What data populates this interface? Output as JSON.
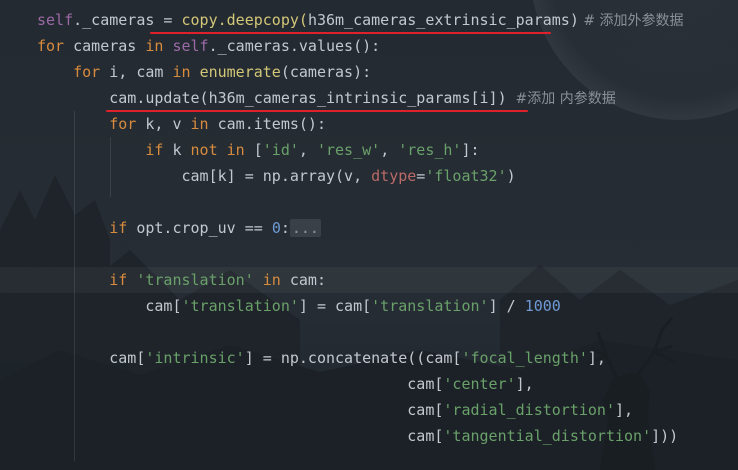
{
  "editor": {
    "lines": [
      {
        "tokens": [
          [
            "self",
            "self"
          ],
          [
            "._cameras = ",
            ""
          ],
          [
            "copy.deepcopy(",
            "fn"
          ],
          [
            "h36m_cameras_extrinsic_params",
            ""
          ],
          [
            ")",
            ""
          ],
          [
            " # 添加外参数据",
            "cm"
          ]
        ]
      },
      {
        "tokens": [
          [
            "for",
            "kw"
          ],
          [
            " cameras ",
            ""
          ],
          [
            "in",
            "kw"
          ],
          [
            " ",
            ""
          ],
          [
            "self",
            "self"
          ],
          [
            "._cameras.values():",
            ""
          ]
        ]
      },
      {
        "tokens": [
          [
            "    ",
            ""
          ],
          [
            "for",
            "kw"
          ],
          [
            " i, cam ",
            ""
          ],
          [
            "in",
            "kw"
          ],
          [
            " ",
            ""
          ],
          [
            "enumerate",
            "fn"
          ],
          [
            "(cameras):",
            ""
          ]
        ]
      },
      {
        "tokens": [
          [
            "        cam.update(h36m_cameras_intrinsic_params[i])",
            ""
          ],
          [
            "  #添加 内参数据",
            "cm"
          ]
        ]
      },
      {
        "tokens": [
          [
            "        ",
            ""
          ],
          [
            "for",
            "kw"
          ],
          [
            " k, v ",
            ""
          ],
          [
            "in",
            "kw"
          ],
          [
            " cam.items():",
            ""
          ]
        ]
      },
      {
        "tokens": [
          [
            "            ",
            ""
          ],
          [
            "if",
            "kw"
          ],
          [
            " k ",
            ""
          ],
          [
            "not in",
            "kw"
          ],
          [
            " [",
            ""
          ],
          [
            "'id'",
            "str"
          ],
          [
            ", ",
            ""
          ],
          [
            "'res_w'",
            "str"
          ],
          [
            ", ",
            ""
          ],
          [
            "'res_h'",
            "str"
          ],
          [
            "]:",
            ""
          ]
        ]
      },
      {
        "tokens": [
          [
            "                cam[k] = np.array(v, ",
            ""
          ],
          [
            "dtype",
            "prm"
          ],
          [
            "=",
            ""
          ],
          [
            "'float32'",
            "str"
          ],
          [
            ")",
            ""
          ]
        ]
      },
      {
        "tokens": []
      },
      {
        "tokens": [
          [
            "        ",
            ""
          ],
          [
            "if",
            "kw"
          ],
          [
            " opt.crop_uv == ",
            ""
          ],
          [
            "0",
            "num"
          ],
          [
            ":",
            ""
          ],
          [
            "...",
            "fold"
          ]
        ]
      },
      {
        "tokens": []
      },
      {
        "tokens": [
          [
            "        ",
            ""
          ],
          [
            "if",
            "kw"
          ],
          [
            " ",
            ""
          ],
          [
            "'translation'",
            "str"
          ],
          [
            " ",
            ""
          ],
          [
            "in",
            "kw"
          ],
          [
            " cam:",
            ""
          ]
        ]
      },
      {
        "tokens": [
          [
            "            cam[",
            ""
          ],
          [
            "'translation'",
            "str"
          ],
          [
            "] = cam[",
            ""
          ],
          [
            "'translation'",
            "str"
          ],
          [
            "] / ",
            ""
          ],
          [
            "1000",
            "num"
          ]
        ]
      },
      {
        "tokens": []
      },
      {
        "tokens": [
          [
            "        cam[",
            ""
          ],
          [
            "'intrinsic'",
            "str"
          ],
          [
            "] = np.concatenate((cam[",
            ""
          ],
          [
            "'focal_length'",
            "str"
          ],
          [
            "],",
            ""
          ]
        ]
      },
      {
        "tokens": [
          [
            "                                         cam[",
            ""
          ],
          [
            "'center'",
            "str"
          ],
          [
            "],",
            ""
          ]
        ]
      },
      {
        "tokens": [
          [
            "                                         cam[",
            ""
          ],
          [
            "'radial_distortion'",
            "str"
          ],
          [
            "],",
            ""
          ]
        ]
      },
      {
        "tokens": [
          [
            "                                         cam[",
            ""
          ],
          [
            "'tangential_distortion'",
            "str"
          ],
          [
            "]))",
            ""
          ]
        ]
      }
    ]
  },
  "colors": {
    "background": "#22272d",
    "keyword": "#d78b3e",
    "string": "#6aa06a",
    "number": "#6e9ad6",
    "self": "#9b6aa6",
    "function": "#d3c778",
    "param": "#b96a66",
    "comment": "#8b9098",
    "annotation_underline": "#e0202a"
  }
}
